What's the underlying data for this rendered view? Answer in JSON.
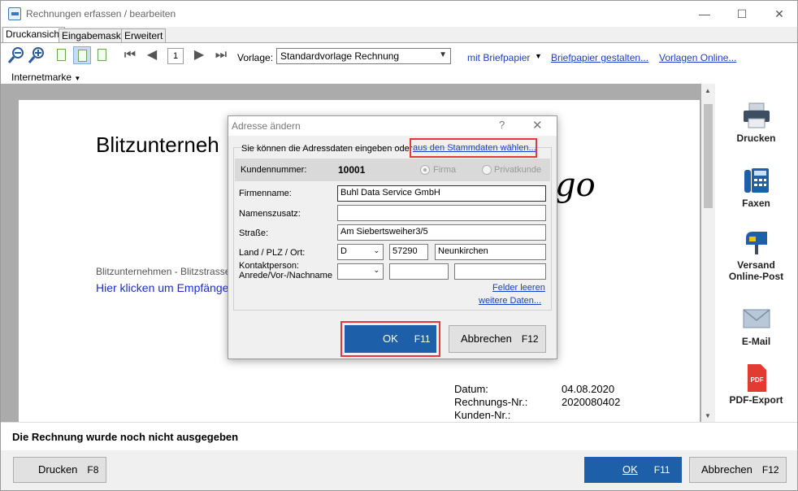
{
  "window": {
    "title": "Rechnungen erfassen / bearbeiten",
    "minimize": "—",
    "maximize": "☐",
    "close": "✕"
  },
  "tabs": [
    "Druckansicht",
    "Eingabemaske",
    "Erweitert"
  ],
  "toolbar": {
    "page": "1",
    "vorlage_label": "Vorlage:",
    "vorlage_value": "Standardvorlage Rechnung",
    "briefpapier": "mit Briefpapier",
    "briefpapier_gestalten": "Briefpapier gestalten...",
    "vorlagen_online": "Vorlagen Online...",
    "internetmarke": "Internetmarke"
  },
  "document": {
    "company_heading": "Blitzunterneh",
    "logo_text": "go",
    "sender_line": "Blitzunternehmen - Blitzstrasse",
    "recipient_link": "Hier klicken um Empfänge",
    "meta": [
      {
        "label": "Datum:",
        "value": "04.08.2020"
      },
      {
        "label": "Rechnungs-Nr.:",
        "value": "2020080402"
      },
      {
        "label": "Kunden-Nr.:",
        "value": ""
      }
    ]
  },
  "sidebar": {
    "drucken": "Drucken",
    "faxen": "Faxen",
    "versand_1": "Versand",
    "versand_2": "Online-Post",
    "email": "E-Mail",
    "pdf": "PDF-Export",
    "pdf_badge": "PDF"
  },
  "status": "Die Rechnung wurde noch nicht ausgegeben",
  "bottom": {
    "drucken": "Drucken",
    "drucken_key": "F8",
    "ok": "OK",
    "ok_key": "F11",
    "abbrechen": "Abbrechen",
    "abbrechen_key": "F12"
  },
  "dialog": {
    "title": "Adresse ändern",
    "help": "?",
    "close": "✕",
    "intro": "Sie können die Adressdaten eingeben oder",
    "stammdaten_link": "aus den Stammdaten wählen...",
    "kundennummer_label": "Kundennummer:",
    "kundennummer": "10001",
    "radio_firma": "Firma",
    "radio_privat": "Privatkunde",
    "firmenname_label": "Firmenname:",
    "firmenname": "Buhl Data Service GmbH",
    "namenszusatz_label": "Namenszusatz:",
    "namenszusatz": "",
    "strasse_label": "Straße:",
    "strasse": "Am Siebertsweiher3/5",
    "land_label": "Land / PLZ / Ort:",
    "land": "D",
    "plz": "57290",
    "ort": "Neunkirchen",
    "kontakt_label_1": "Kontaktperson:",
    "kontakt_label_2": "Anrede/Vor-/Nachname",
    "felder_leeren": "Felder leeren",
    "weitere_daten": "weitere Daten...",
    "ok": "OK",
    "ok_key": "F11",
    "abbrechen": "Abbrechen",
    "abbrechen_key": "F12"
  }
}
